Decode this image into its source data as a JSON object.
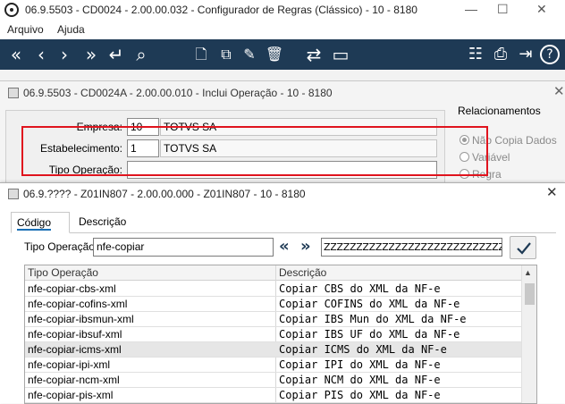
{
  "main_window": {
    "title": "06.9.5503 - CD0024 - 2.00.00.032 - Configurador de Regras (Clássico) - 10 - 8180",
    "menu": [
      "Arquivo",
      "Ajuda"
    ],
    "toolbar_icons": [
      "first-icon",
      "previous-icon",
      "next-icon",
      "last-icon",
      "goto-icon",
      "search-icon",
      "new-icon",
      "copy-icon",
      "edit-icon",
      "delete-icon",
      "swap-icon",
      "screen-icon",
      "tree-icon",
      "print-icon",
      "exit-icon",
      "help-icon"
    ],
    "toolbar_glyphs": {
      "first": "«",
      "previous": "‹",
      "next": "›",
      "last": "»",
      "goto": "↵",
      "search": "⌕",
      "new": "🗋",
      "copy": "⧉",
      "edit": "✎",
      "delete": "🗑",
      "swap": "⇄",
      "screen": "▭",
      "tree": "☷",
      "print": "⎙",
      "exit": "⇥",
      "help": "?"
    },
    "window_controls": {
      "minimize": "—",
      "maximize": "☐",
      "close": "✕"
    }
  },
  "insert_window": {
    "title": "06.9.5503 - CD0024A - 2.00.00.010 - Inclui Operação - 10 - 8180",
    "close": "✕",
    "fields": {
      "empresa_label": "Empresa:",
      "empresa_code": "10",
      "empresa_name": "TOTVS SA",
      "estab_label": "Estabelecimento:",
      "estab_code": "1",
      "estab_name": "TOTVS SA",
      "tipo_label": "Tipo Operação:",
      "tipo_value": ""
    },
    "relacionamentos": {
      "title": "Relacionamentos",
      "options": [
        "Não Copia Dados",
        "Variável",
        "Regra"
      ],
      "selected": "Não Copia Dados"
    }
  },
  "lookup_window": {
    "title": "06.9.???? - Z01IN807 - 2.00.00.000 - Z01IN807 - 10 - 8180",
    "close": "✕",
    "tabs": [
      "Código",
      "Descrição"
    ],
    "active_tab": "Código",
    "search": {
      "label": "Tipo Operação:",
      "value": "nfe-copiar",
      "range_end": "ZZZZZZZZZZZZZZZZZZZZZZZZZZZZZZZZ",
      "prev_glyph": "«",
      "next_glyph": "»"
    },
    "grid": {
      "columns": [
        "Tipo Operação",
        "Descrição"
      ],
      "rows": [
        [
          "nfe-copiar-cbs-xml",
          "Copiar CBS do XML da NF-e"
        ],
        [
          "nfe-copiar-cofins-xml",
          "Copiar COFINS do XML da NF-e"
        ],
        [
          "nfe-copiar-ibsmun-xml",
          "Copiar IBS Mun do XML da NF-e"
        ],
        [
          "nfe-copiar-ibsuf-xml",
          "Copiar IBS UF do XML da NF-e"
        ],
        [
          "nfe-copiar-icms-xml",
          "Copiar ICMS do XML da NF-e"
        ],
        [
          "nfe-copiar-ipi-xml",
          "Copiar IPI do XML da NF-e"
        ],
        [
          "nfe-copiar-ncm-xml",
          "Copiar NCM do XML da NF-e"
        ],
        [
          "nfe-copiar-pis-xml",
          "Copiar PIS do XML da NF-e"
        ]
      ],
      "selected_row": 4,
      "highlighted_rows": [
        2,
        3,
        4
      ],
      "highlight_color": "#e0141e"
    }
  },
  "colors": {
    "toolbar": "#1e3a55",
    "accent": "#1a6fb5"
  }
}
